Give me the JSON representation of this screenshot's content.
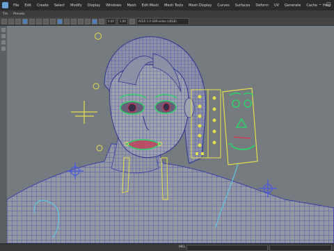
{
  "app": {
    "brand_color": "#6aa3d8"
  },
  "menubar": {
    "items": [
      "File",
      "Edit",
      "Create",
      "Select",
      "Modify",
      "Display",
      "Windows",
      "Mesh",
      "Edit Mesh",
      "Mesh Tools",
      "Mesh Display",
      "Curves",
      "Surfaces",
      "Deform",
      "UV",
      "Generate",
      "Cache",
      "Help"
    ]
  },
  "shelf": {
    "tabs": [
      "Polygons",
      "Rendering",
      "Deform"
    ],
    "label_left": "Tm",
    "label_next": "Presets"
  },
  "toolbar": {
    "field1": "0.00",
    "field2": "1.00",
    "colorspace": "ACES 1.0 SDR-video (sRGB)"
  },
  "statusbar": {
    "mel_label": "MEL"
  },
  "colors": {
    "mesh_wire": "#3a3fa8",
    "mesh_fill": "#9498a3",
    "viewport_bg": "#767b80",
    "rig_yellow": "#e6e04a",
    "rig_green": "#2fcf6a",
    "rig_red": "#d8344c",
    "rig_blue": "#4e5bd6",
    "curve_cyan": "#5fc8e0"
  }
}
